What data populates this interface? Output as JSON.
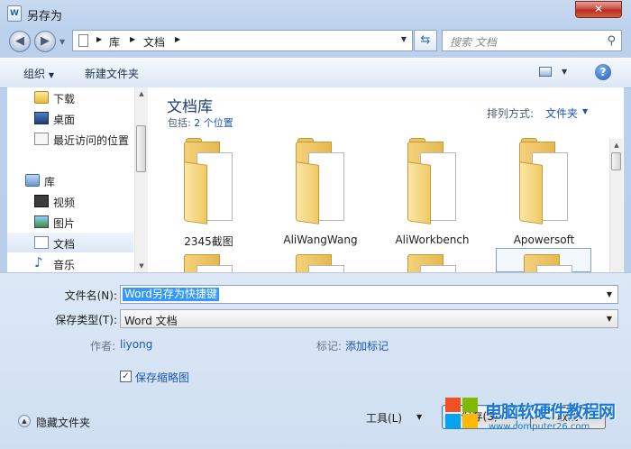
{
  "window": {
    "title": "另存为",
    "close_glyph": "✕",
    "app_icon_text": "W"
  },
  "nav": {
    "back_glyph": "◀",
    "forward_glyph": "▶",
    "breadcrumbs": [
      "库",
      "文档"
    ],
    "search_placeholder": "搜索 文档"
  },
  "toolbar": {
    "organize": "组织",
    "new_folder": "新建文件夹",
    "help_glyph": "?"
  },
  "sidebar": {
    "items": [
      {
        "label": "下载",
        "icon": "downloads-folder-icon"
      },
      {
        "label": "桌面",
        "icon": "desktop-icon"
      },
      {
        "label": "最近访问的位置",
        "icon": "recent-places-icon"
      },
      {
        "label": "库",
        "icon": "library-icon"
      },
      {
        "label": "视频",
        "icon": "video-icon"
      },
      {
        "label": "图片",
        "icon": "pictures-icon"
      },
      {
        "label": "文档",
        "icon": "documents-icon",
        "selected": true
      },
      {
        "label": "音乐",
        "icon": "music-icon"
      }
    ]
  },
  "library": {
    "title": "文档库",
    "includes_label": "包括:",
    "includes_link": "2 个位置",
    "arrange_label": "排列方式:",
    "arrange_value": "文件夹"
  },
  "folders": [
    {
      "name": "2345截图"
    },
    {
      "name": "AliWangWang"
    },
    {
      "name": "AliWorkbench"
    },
    {
      "name": "Apowersoft"
    }
  ],
  "form": {
    "filename_label": "文件名(N):",
    "filename_value": "Word另存为快捷键",
    "filetype_label": "保存类型(T):",
    "filetype_value": "Word 文档",
    "author_label": "作者:",
    "author_value": "liyong",
    "tags_label": "标记:",
    "tags_value": "添加标记",
    "thumbnail_label": "保存缩略图",
    "thumbnail_checked": true,
    "hide_folders": "隐藏文件夹",
    "tools": "工具(L)",
    "save": "保存(S)",
    "cancel": "取消"
  },
  "watermark": {
    "title": "电脑软硬件教程网",
    "url": "www.computer26.com"
  },
  "colors": {
    "accent": "#1b56b8",
    "title_blue": "#1e3f78",
    "selection": "#3399ff"
  }
}
